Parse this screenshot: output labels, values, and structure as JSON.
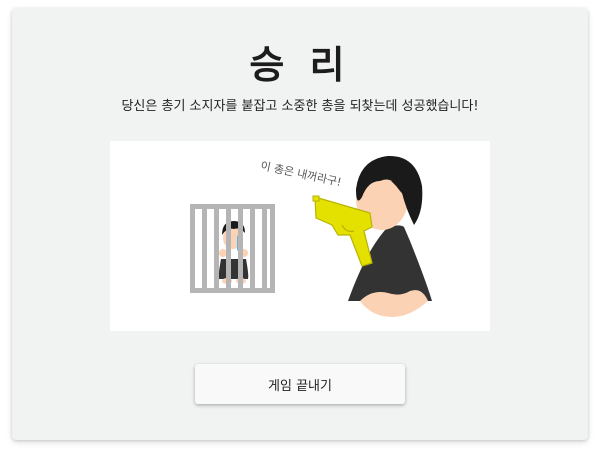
{
  "title": "승 리",
  "message": "당신은 총기 소지자를 붙잡고 소중한 총을 되찾는데 성공했습니다!",
  "scene": {
    "speech": "이 총은 내꺼라구!",
    "colors": {
      "gun": "#e4e000",
      "jail_bars": "#b5b5b5",
      "hair": "#1a1a1a",
      "skin": "#fcd2b5",
      "clothes": "#333333",
      "tears": "#5fb5e6"
    },
    "icons": [
      "jail-icon",
      "prisoner-icon",
      "gun-icon",
      "owner-icon"
    ]
  },
  "end_button": {
    "label": "게임 끝내기"
  }
}
